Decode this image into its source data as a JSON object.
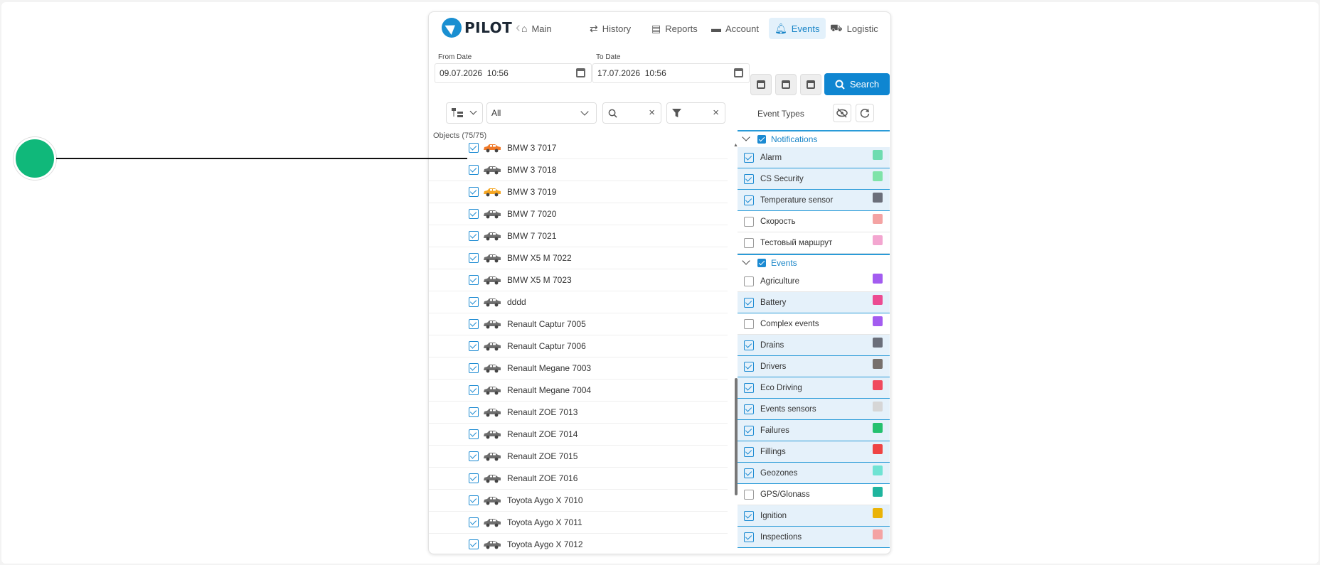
{
  "app": {
    "logo_text": "PILOT"
  },
  "nav": {
    "items": [
      {
        "label": "Main",
        "icon": "home-icon"
      },
      {
        "label": "History",
        "icon": "history-icon"
      },
      {
        "label": "Reports",
        "icon": "document-icon"
      },
      {
        "label": "Account",
        "icon": "wallet-icon"
      },
      {
        "label": "Events",
        "icon": "bell-icon",
        "active": true
      },
      {
        "label": "Logistic",
        "icon": "truck-icon"
      }
    ]
  },
  "dates": {
    "from_label": "From Date",
    "from_value": "09.07.2026  10:56",
    "to_label": "To Date",
    "to_value": "17.07.2026  10:56"
  },
  "search_button": {
    "label": "Search"
  },
  "filters": {
    "group_select": "All"
  },
  "objects": {
    "header": "Objects (75/75)",
    "items": [
      {
        "name": "BMW 3 7017",
        "color": "#f07a2a"
      },
      {
        "name": "BMW 3 7018",
        "color": "#6e6e6e"
      },
      {
        "name": "BMW 3 7019",
        "color": "#f5a623"
      },
      {
        "name": "BMW 7 7020",
        "color": "#6e6e6e"
      },
      {
        "name": "BMW 7 7021",
        "color": "#6e6e6e"
      },
      {
        "name": "BMW X5 M 7022",
        "color": "#6e6e6e"
      },
      {
        "name": "BMW X5 M 7023",
        "color": "#6e6e6e"
      },
      {
        "name": "dddd",
        "color": "#6e6e6e"
      },
      {
        "name": "Renault Captur 7005",
        "color": "#6e6e6e"
      },
      {
        "name": "Renault Captur 7006",
        "color": "#6e6e6e"
      },
      {
        "name": "Renault Megane 7003",
        "color": "#6e6e6e"
      },
      {
        "name": "Renault Megane 7004",
        "color": "#6e6e6e"
      },
      {
        "name": "Renault ZOE 7013",
        "color": "#6e6e6e"
      },
      {
        "name": "Renault ZOE 7014",
        "color": "#6e6e6e"
      },
      {
        "name": "Renault ZOE 7015",
        "color": "#6e6e6e"
      },
      {
        "name": "Renault ZOE 7016",
        "color": "#6e6e6e"
      },
      {
        "name": "Toyota Aygo X 7010",
        "color": "#6e6e6e"
      },
      {
        "name": "Toyota Aygo X 7011",
        "color": "#6e6e6e"
      },
      {
        "name": "Toyota Aygo X 7012",
        "color": "#6e6e6e"
      }
    ]
  },
  "event_types": {
    "title": "Event Types",
    "groups": [
      {
        "name": "Notifications",
        "items": [
          {
            "name": "Alarm",
            "checked": true,
            "color": "#6fdcb0"
          },
          {
            "name": "CS Security",
            "checked": true,
            "color": "#7fe3a8"
          },
          {
            "name": "Temperature sensor",
            "checked": true,
            "color": "#6b6f7a"
          },
          {
            "name": "Скорость",
            "checked": false,
            "color": "#f4a3a3"
          },
          {
            "name": "Тестовый маршрут",
            "checked": false,
            "color": "#f3a6d0"
          }
        ]
      },
      {
        "name": "Events",
        "items": [
          {
            "name": "Agriculture",
            "checked": false,
            "color": "#a35cf0"
          },
          {
            "name": "Battery",
            "checked": true,
            "color": "#ec4b91"
          },
          {
            "name": "Complex events",
            "checked": false,
            "color": "#a35cf0"
          },
          {
            "name": "Drains",
            "checked": true,
            "color": "#6b6f7a"
          },
          {
            "name": "Drivers",
            "checked": true,
            "color": "#77706c"
          },
          {
            "name": "Eco Driving",
            "checked": true,
            "color": "#f04a5e"
          },
          {
            "name": "Events sensors",
            "checked": true,
            "color": "#d6d6d6"
          },
          {
            "name": "Failures",
            "checked": true,
            "color": "#25c16f"
          },
          {
            "name": "Fillings",
            "checked": true,
            "color": "#ef4444"
          },
          {
            "name": "Geozones",
            "checked": true,
            "color": "#6fe3d3"
          },
          {
            "name": "GPS/Glonass",
            "checked": false,
            "color": "#1fb59e"
          },
          {
            "name": "Ignition",
            "checked": true,
            "color": "#eab308"
          },
          {
            "name": "Inspections",
            "checked": true,
            "color": "#f4a3a3"
          }
        ]
      }
    ]
  }
}
